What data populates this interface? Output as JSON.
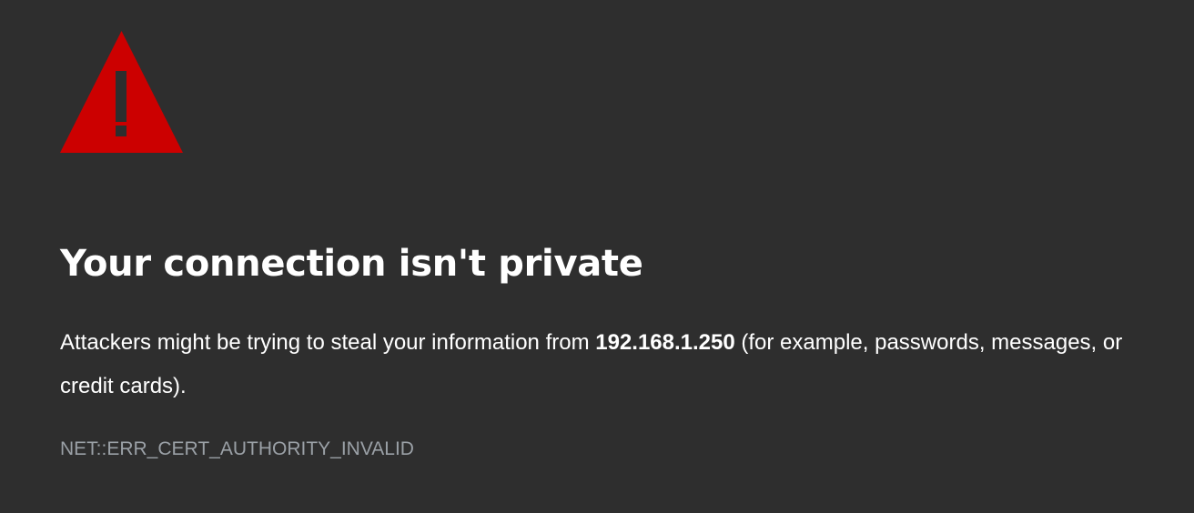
{
  "warning": {
    "icon": "warning-triangle-icon",
    "color": "#cc0000"
  },
  "title": "Your connection isn't private",
  "description": {
    "prefix": "Attackers might be trying to steal your information from ",
    "host": "192.168.1.250",
    "suffix": " (for example, passwords, messages, or credit cards)."
  },
  "error_code": "NET::ERR_CERT_AUTHORITY_INVALID",
  "colors": {
    "background": "#2e2e2e",
    "text": "#ffffff",
    "muted_text": "#9aa0a6",
    "alert": "#cc0000"
  }
}
